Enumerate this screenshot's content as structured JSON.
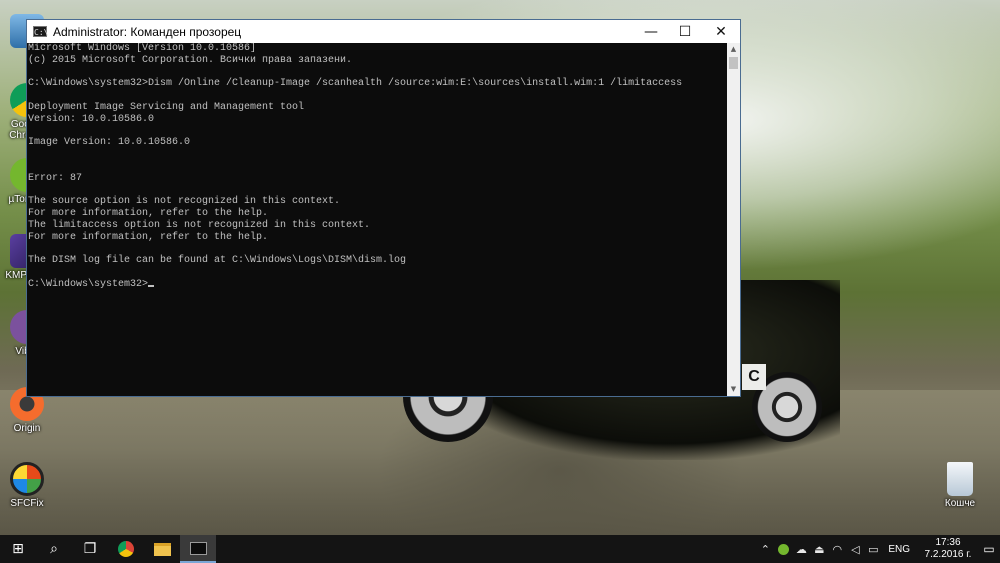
{
  "desktop": {
    "icons": [
      {
        "label": "",
        "icon": "computer-icon"
      },
      {
        "label": "Google Chrome",
        "icon": "chrome-icon"
      },
      {
        "label": "µTorrent",
        "icon": "utorrent-icon"
      },
      {
        "label": "KMPlayer",
        "icon": "kmplayer-icon"
      },
      {
        "label": "Viber",
        "icon": "viber-icon"
      },
      {
        "label": "Origin",
        "icon": "origin-icon"
      },
      {
        "label": "SFCFix",
        "icon": "sfcfix-icon"
      },
      {
        "label": "Кошче",
        "icon": "recycle-bin-icon"
      }
    ],
    "wallpaper_plate": "C"
  },
  "window": {
    "title": "Administrator: Команден прозорец",
    "controls": {
      "minimize": "—",
      "maximize": "☐",
      "close": "✕"
    },
    "console_lines": [
      "Microsoft Windows [Version 10.0.10586]",
      "(c) 2015 Microsoft Corporation. Всички права запазени.",
      "",
      "C:\\Windows\\system32>Dism /Online /Cleanup-Image /scanhealth /source:wim:E:\\sources\\install.wim:1 /limitaccess",
      "",
      "Deployment Image Servicing and Management tool",
      "Version: 10.0.10586.0",
      "",
      "Image Version: 10.0.10586.0",
      "",
      "",
      "Error: 87",
      "",
      "The source option is not recognized in this context.",
      "For more information, refer to the help.",
      "The limitaccess option is not recognized in this context.",
      "For more information, refer to the help.",
      "",
      "The DISM log file can be found at C:\\Windows\\Logs\\DISM\\dism.log",
      ""
    ],
    "prompt": "C:\\Windows\\system32>",
    "colors": {
      "background": "#0c0c0c",
      "text": "#c0c0c0"
    }
  },
  "taskbar": {
    "buttons": [
      {
        "name": "start-button",
        "glyph": "⊞"
      },
      {
        "name": "search-button",
        "glyph": "⌕"
      },
      {
        "name": "task-view-button",
        "glyph": "❐"
      },
      {
        "name": "chrome-taskbar-button",
        "glyph": "●"
      },
      {
        "name": "file-explorer-taskbar-button",
        "glyph": "▬"
      },
      {
        "name": "cmd-taskbar-button",
        "glyph": "▣"
      }
    ],
    "tray": {
      "icons": [
        "chevron-up-icon",
        "utorrent-tray-icon",
        "onedrive-icon",
        "usb-icon",
        "wifi-icon",
        "volume-icon",
        "keyboard-icon"
      ],
      "glyphs": [
        "⌃",
        "◉",
        "☁",
        "⏏",
        "◠",
        "◁",
        "▭"
      ],
      "language": "ENG",
      "time": "17:36",
      "date": "7.2.2016 г."
    }
  }
}
